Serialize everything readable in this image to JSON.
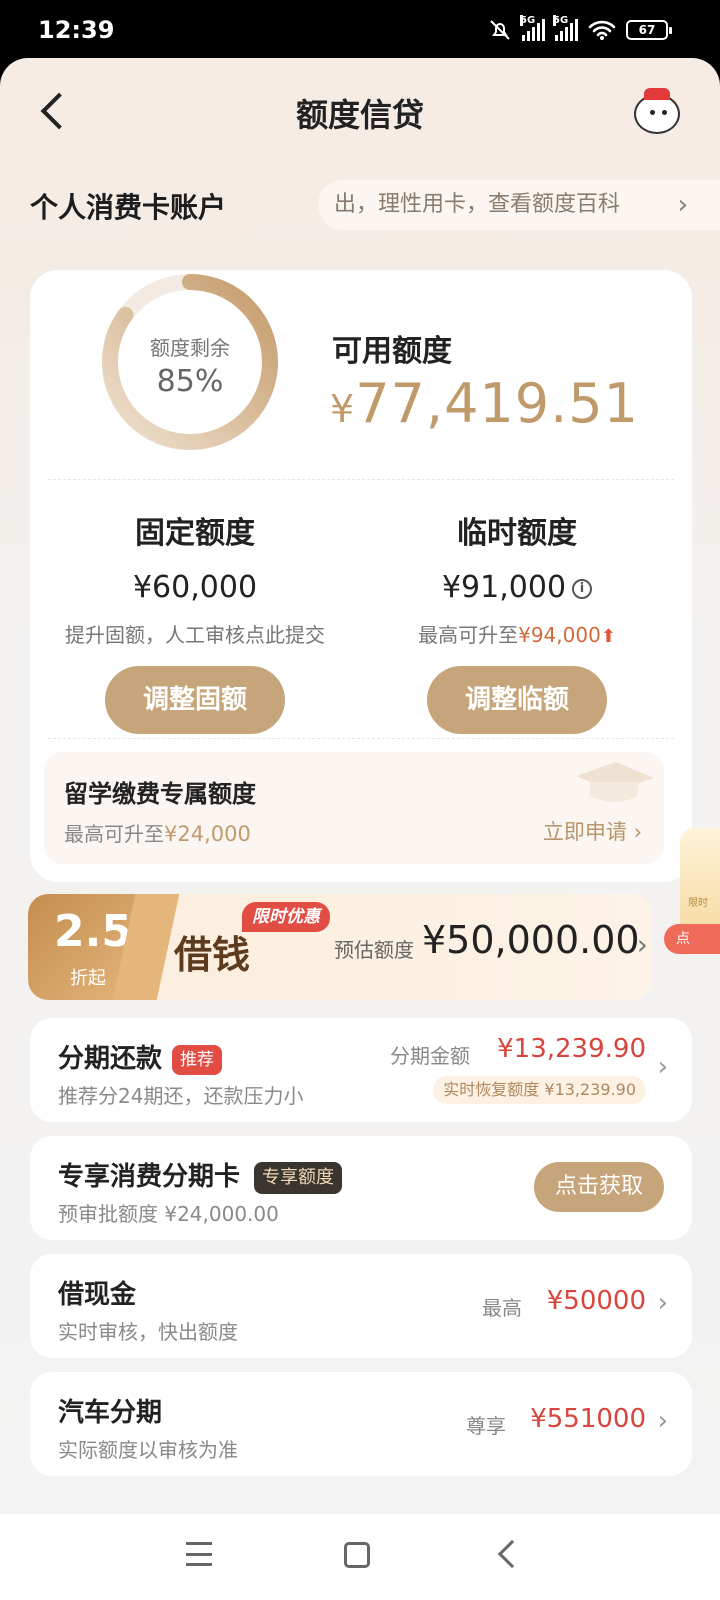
{
  "status": {
    "time": "12:39",
    "battery": "67",
    "net1": "5G",
    "net2": "5G"
  },
  "header": {
    "title": "额度信贷"
  },
  "account": {
    "title": "个人消费卡账户",
    "tip": "出，理性用卡，查看额度百科",
    "tip_chevron": "›"
  },
  "summary": {
    "ring_label": "额度剩余",
    "ring_percent": "85%",
    "ring_fraction": 0.85,
    "available_label": "可用额度",
    "currency": "¥",
    "available_amount": "77,419.51"
  },
  "fixed": {
    "label": "固定额度",
    "amount": "¥60,000",
    "note": "提升固额，人工审核点此提交",
    "button": "调整固额"
  },
  "temp": {
    "label": "临时额度",
    "amount": "¥91,000",
    "info_icon": "i",
    "note_prefix": "最高可升至",
    "note_value": "¥94,000",
    "up_arrow": "⬆",
    "button": "调整临额"
  },
  "study": {
    "title": "留学缴费专属额度",
    "note_prefix": "最高可升至",
    "note_value": "¥24,000",
    "action": "立即申请 ›"
  },
  "loan": {
    "discount": "2.5",
    "discount_suffix": "折起",
    "tag": "限时优惠",
    "title": "借钱",
    "estimate_label": "预估额度",
    "estimate_value": "¥50,000.00",
    "chevron": "›",
    "side_tag": "点",
    "side_text": "限时"
  },
  "services": [
    {
      "title": "分期还款",
      "tag": "推荐",
      "subtitle": "推荐分24期还，还款压力小",
      "right_label": "分期金额",
      "right_value": "¥13,239.90",
      "pill": "实时恢复额度 ¥13,239.90",
      "chevron": "›"
    },
    {
      "title": "专享消费分期卡",
      "tag": "专享额度",
      "subtitle": "预审批额度 ¥24,000.00",
      "button": "点击获取"
    },
    {
      "title": "借现金",
      "subtitle": "实时审核，快出额度",
      "right_label": "最高",
      "right_value": "¥50000",
      "chevron": "›"
    },
    {
      "title": "汽车分期",
      "subtitle": "实际额度以审核为准",
      "right_label": "尊享",
      "right_value": "¥551000",
      "chevron": "›"
    }
  ],
  "colors": {
    "accent": "#c7a57a",
    "gold_text": "#c09a6a",
    "red": "#d8453c"
  }
}
